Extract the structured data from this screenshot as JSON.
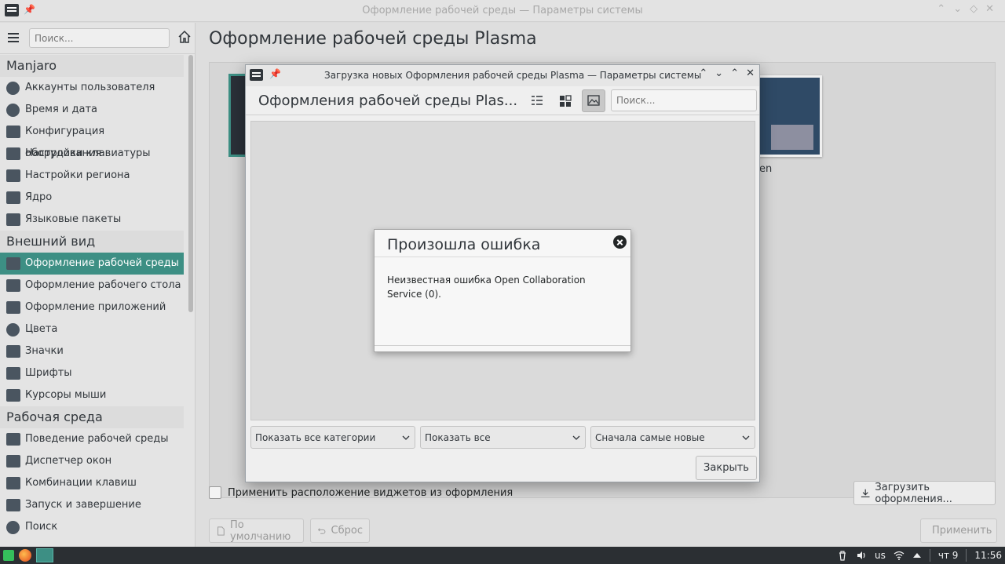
{
  "window": {
    "title": "Оформление рабочей среды — Параметры системы",
    "controls": [
      "⌃",
      "⌄",
      "◇",
      "✕"
    ]
  },
  "sidebar": {
    "search_placeholder": "Поиск...",
    "sections": [
      {
        "header": "Manjaro",
        "items": [
          {
            "label": "Аккаунты пользователя",
            "icon": "users-icon"
          },
          {
            "label": "Время и дата",
            "icon": "clock-icon"
          },
          {
            "label": "Конфигурация оборудования",
            "icon": "hardware-icon"
          },
          {
            "label": "Настройки клавиатуры",
            "icon": "keyboard-icon"
          },
          {
            "label": "Настройки региона",
            "icon": "region-icon"
          },
          {
            "label": "Ядро",
            "icon": "kernel-icon"
          },
          {
            "label": "Языковые пакеты",
            "icon": "language-packs-icon"
          }
        ]
      },
      {
        "header": "Внешний вид",
        "items": [
          {
            "label": "Оформление рабочей среды",
            "icon": "workspace-theme-icon",
            "active": true
          },
          {
            "label": "Оформление рабочего стола",
            "icon": "desktop-theme-icon"
          },
          {
            "label": "Оформление приложений",
            "icon": "application-style-icon"
          },
          {
            "label": "Цвета",
            "icon": "colors-icon"
          },
          {
            "label": "Значки",
            "icon": "icons-icon"
          },
          {
            "label": "Шрифты",
            "icon": "fonts-icon"
          },
          {
            "label": "Курсоры мыши",
            "icon": "cursors-icon"
          }
        ]
      },
      {
        "header": "Рабочая среда",
        "items": [
          {
            "label": "Поведение рабочей среды",
            "icon": "workspace-behavior-icon"
          },
          {
            "label": "Диспетчер окон",
            "icon": "window-manager-icon"
          },
          {
            "label": "Комбинации клавиш",
            "icon": "shortcuts-icon"
          },
          {
            "label": "Запуск и завершение",
            "icon": "startup-icon"
          },
          {
            "label": "Поиск",
            "icon": "search-icon"
          }
        ]
      }
    ]
  },
  "content": {
    "page_title": "Оформление рабочей среды Plasma",
    "thumb_label": "en",
    "checkbox_label": "Применить расположение виджетов из оформления",
    "download_label": "Загрузить оформления...",
    "defaults_label": "По умолчанию",
    "reset_label": "Сброс",
    "apply_label": "Применить"
  },
  "dialog": {
    "title": "Загрузка новых Оформления рабочей среды Plasma — Параметры системы",
    "heading": "Оформления рабочей среды Plas...",
    "search_placeholder": "Поиск...",
    "controls": [
      "⌃",
      "⌄",
      "⌃",
      "✕"
    ],
    "filters": {
      "category": "Показать все категории",
      "show": "Показать все",
      "sort": "Сначала самые новые"
    },
    "close_label": "Закрыть"
  },
  "error": {
    "title": "Произошла ошибка",
    "message": "Неизвестная ошибка Open Collaboration Service (0)."
  },
  "taskbar": {
    "keyboard_layout": "us",
    "date": "чт 9",
    "time": "11:56"
  },
  "colors": {
    "accent": "#3d8f84",
    "panel": "#2b2f33"
  }
}
